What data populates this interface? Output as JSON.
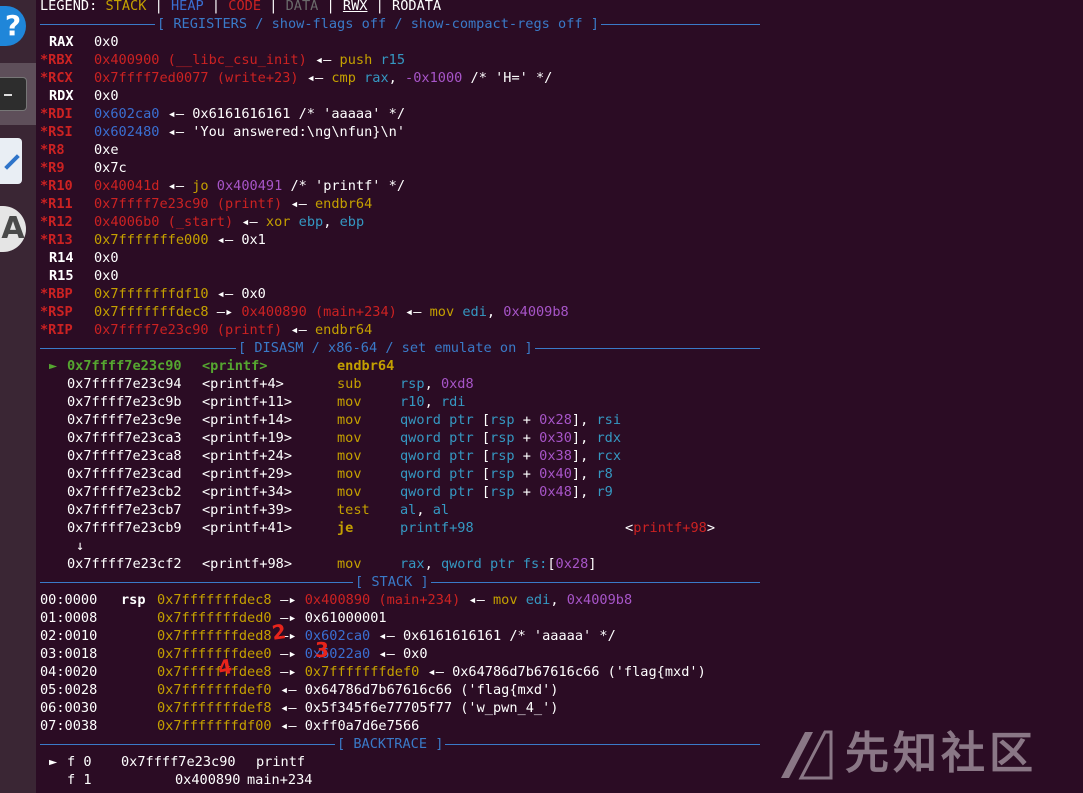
{
  "legend": {
    "label": "LEGEND:",
    "items": [
      "STACK",
      "HEAP",
      "CODE",
      "DATA",
      "RWX",
      "RODATA"
    ],
    "separator": "|"
  },
  "headers": {
    "registers": "[ REGISTERS / show-flags off / show-compact-regs off ]",
    "disasm": "[ DISASM / x86-64 / set emulate on ]",
    "stack": "[ STACK ]",
    "backtrace": "[ BACKTRACE ]"
  },
  "registers": [
    {
      "name": "RAX",
      "changed": false,
      "parts": [
        {
          "t": "0x0",
          "c": "w"
        }
      ]
    },
    {
      "name": "*RBX",
      "changed": true,
      "parts": [
        {
          "t": "0x400900 (__libc_csu_init)",
          "c": "r"
        },
        {
          "t": " ◂— ",
          "c": "w"
        },
        {
          "t": "push",
          "c": "y"
        },
        {
          "t": " ",
          "c": "w"
        },
        {
          "t": "r15",
          "c": "c"
        }
      ]
    },
    {
      "name": "*RCX",
      "changed": true,
      "parts": [
        {
          "t": "0x7ffff7ed0077 (write+23)",
          "c": "r"
        },
        {
          "t": " ◂— ",
          "c": "w"
        },
        {
          "t": "cmp",
          "c": "y"
        },
        {
          "t": " ",
          "c": "w"
        },
        {
          "t": "rax",
          "c": "c"
        },
        {
          "t": ", ",
          "c": "w"
        },
        {
          "t": "-0x1000",
          "c": "m"
        },
        {
          "t": " /* 'H=' */",
          "c": "w"
        }
      ]
    },
    {
      "name": "RDX",
      "changed": false,
      "parts": [
        {
          "t": "0x0",
          "c": "w"
        }
      ]
    },
    {
      "name": "*RDI",
      "changed": true,
      "parts": [
        {
          "t": "0x602ca0",
          "c": "b"
        },
        {
          "t": " ◂— 0x6161616161 /* 'aaaaa' */",
          "c": "w"
        }
      ]
    },
    {
      "name": "*RSI",
      "changed": true,
      "parts": [
        {
          "t": "0x602480",
          "c": "b"
        },
        {
          "t": " ◂— 'You answered:\\ng\\nfun}\\n'",
          "c": "w"
        }
      ]
    },
    {
      "name": "*R8",
      "changed": true,
      "parts": [
        {
          "t": "0xe",
          "c": "w"
        }
      ]
    },
    {
      "name": "*R9",
      "changed": true,
      "parts": [
        {
          "t": "0x7c",
          "c": "w"
        }
      ]
    },
    {
      "name": "*R10",
      "changed": true,
      "parts": [
        {
          "t": "0x40041d",
          "c": "r"
        },
        {
          "t": " ◂— ",
          "c": "w"
        },
        {
          "t": "jo",
          "c": "y"
        },
        {
          "t": " ",
          "c": "w"
        },
        {
          "t": "0x400491",
          "c": "m"
        },
        {
          "t": " /* 'printf' */",
          "c": "w"
        }
      ]
    },
    {
      "name": "*R11",
      "changed": true,
      "parts": [
        {
          "t": "0x7ffff7e23c90 (printf)",
          "c": "r"
        },
        {
          "t": " ◂— ",
          "c": "w"
        },
        {
          "t": "endbr64",
          "c": "y"
        }
      ]
    },
    {
      "name": "*R12",
      "changed": true,
      "parts": [
        {
          "t": "0x4006b0 (_start)",
          "c": "r"
        },
        {
          "t": " ◂— ",
          "c": "w"
        },
        {
          "t": "xor",
          "c": "y"
        },
        {
          "t": " ",
          "c": "w"
        },
        {
          "t": "ebp",
          "c": "c"
        },
        {
          "t": ", ",
          "c": "w"
        },
        {
          "t": "ebp",
          "c": "c"
        }
      ]
    },
    {
      "name": "*R13",
      "changed": true,
      "parts": [
        {
          "t": "0x7fffffffe000",
          "c": "y"
        },
        {
          "t": " ◂— 0x1",
          "c": "w"
        }
      ]
    },
    {
      "name": "R14",
      "changed": false,
      "parts": [
        {
          "t": "0x0",
          "c": "w"
        }
      ]
    },
    {
      "name": "R15",
      "changed": false,
      "parts": [
        {
          "t": "0x0",
          "c": "w"
        }
      ]
    },
    {
      "name": "*RBP",
      "changed": true,
      "parts": [
        {
          "t": "0x7fffffffdf10",
          "c": "y"
        },
        {
          "t": " ◂— 0x0",
          "c": "w"
        }
      ]
    },
    {
      "name": "*RSP",
      "changed": true,
      "parts": [
        {
          "t": "0x7fffffffdec8",
          "c": "y"
        },
        {
          "t": " —▸ ",
          "c": "w"
        },
        {
          "t": "0x400890 (main+234)",
          "c": "r"
        },
        {
          "t": " ◂— ",
          "c": "w"
        },
        {
          "t": "mov",
          "c": "y"
        },
        {
          "t": " ",
          "c": "w"
        },
        {
          "t": "edi",
          "c": "c"
        },
        {
          "t": ", ",
          "c": "w"
        },
        {
          "t": "0x4009b8",
          "c": "m"
        }
      ]
    },
    {
      "name": "*RIP",
      "changed": true,
      "parts": [
        {
          "t": "0x7ffff7e23c90 (printf)",
          "c": "r"
        },
        {
          "t": " ◂— ",
          "c": "w"
        },
        {
          "t": "endbr64",
          "c": "y"
        }
      ]
    }
  ],
  "disasm": [
    {
      "ptr": "►",
      "addr": "0x7ffff7e23c90",
      "sym": "<printf>",
      "mn": "endbr64",
      "op": "",
      "current": true
    },
    {
      "ptr": "",
      "addr": "0x7ffff7e23c94",
      "sym": "<printf+4>",
      "mn": "sub",
      "op": [
        {
          "t": "rsp",
          "c": "c"
        },
        {
          "t": ", ",
          "c": "w"
        },
        {
          "t": "0xd8",
          "c": "m"
        }
      ]
    },
    {
      "ptr": "",
      "addr": "0x7ffff7e23c9b",
      "sym": "<printf+11>",
      "mn": "mov",
      "op": [
        {
          "t": "r10",
          "c": "c"
        },
        {
          "t": ", ",
          "c": "w"
        },
        {
          "t": "rdi",
          "c": "c"
        }
      ]
    },
    {
      "ptr": "",
      "addr": "0x7ffff7e23c9e",
      "sym": "<printf+14>",
      "mn": "mov",
      "op": [
        {
          "t": "qword ptr",
          "c": "c"
        },
        {
          "t": " [",
          "c": "w"
        },
        {
          "t": "rsp",
          "c": "c"
        },
        {
          "t": " + ",
          "c": "w"
        },
        {
          "t": "0x28",
          "c": "m"
        },
        {
          "t": "], ",
          "c": "w"
        },
        {
          "t": "rsi",
          "c": "c"
        }
      ]
    },
    {
      "ptr": "",
      "addr": "0x7ffff7e23ca3",
      "sym": "<printf+19>",
      "mn": "mov",
      "op": [
        {
          "t": "qword ptr",
          "c": "c"
        },
        {
          "t": " [",
          "c": "w"
        },
        {
          "t": "rsp",
          "c": "c"
        },
        {
          "t": " + ",
          "c": "w"
        },
        {
          "t": "0x30",
          "c": "m"
        },
        {
          "t": "], ",
          "c": "w"
        },
        {
          "t": "rdx",
          "c": "c"
        }
      ]
    },
    {
      "ptr": "",
      "addr": "0x7ffff7e23ca8",
      "sym": "<printf+24>",
      "mn": "mov",
      "op": [
        {
          "t": "qword ptr",
          "c": "c"
        },
        {
          "t": " [",
          "c": "w"
        },
        {
          "t": "rsp",
          "c": "c"
        },
        {
          "t": " + ",
          "c": "w"
        },
        {
          "t": "0x38",
          "c": "m"
        },
        {
          "t": "], ",
          "c": "w"
        },
        {
          "t": "rcx",
          "c": "c"
        }
      ]
    },
    {
      "ptr": "",
      "addr": "0x7ffff7e23cad",
      "sym": "<printf+29>",
      "mn": "mov",
      "op": [
        {
          "t": "qword ptr",
          "c": "c"
        },
        {
          "t": " [",
          "c": "w"
        },
        {
          "t": "rsp",
          "c": "c"
        },
        {
          "t": " + ",
          "c": "w"
        },
        {
          "t": "0x40",
          "c": "m"
        },
        {
          "t": "], ",
          "c": "w"
        },
        {
          "t": "r8",
          "c": "c"
        }
      ]
    },
    {
      "ptr": "",
      "addr": "0x7ffff7e23cb2",
      "sym": "<printf+34>",
      "mn": "mov",
      "op": [
        {
          "t": "qword ptr",
          "c": "c"
        },
        {
          "t": " [",
          "c": "w"
        },
        {
          "t": "rsp",
          "c": "c"
        },
        {
          "t": " + ",
          "c": "w"
        },
        {
          "t": "0x48",
          "c": "m"
        },
        {
          "t": "], ",
          "c": "w"
        },
        {
          "t": "r9",
          "c": "c"
        }
      ]
    },
    {
      "ptr": "",
      "addr": "0x7ffff7e23cb7",
      "sym": "<printf+39>",
      "mn": "test",
      "op": [
        {
          "t": "al",
          "c": "c"
        },
        {
          "t": ", ",
          "c": "w"
        },
        {
          "t": "al",
          "c": "c"
        }
      ]
    },
    {
      "ptr": "",
      "addr": "0x7ffff7e23cb9",
      "sym": "<printf+41>",
      "mn": "je",
      "mnbold": true,
      "op": [
        {
          "t": "printf+98",
          "c": "c"
        }
      ],
      "extra": [
        {
          "t": "<",
          "c": "w"
        },
        {
          "t": "printf+98",
          "c": "r"
        },
        {
          "t": ">",
          "c": "w"
        }
      ]
    },
    {
      "arrow": "↓"
    },
    {
      "ptr": "",
      "addr": "0x7ffff7e23cf2",
      "sym": "<printf+98>",
      "mn": "mov",
      "op": [
        {
          "t": "rax",
          "c": "c"
        },
        {
          "t": ", ",
          "c": "w"
        },
        {
          "t": "qword ptr fs:",
          "c": "c"
        },
        {
          "t": "[",
          "c": "w"
        },
        {
          "t": "0x28",
          "c": "m"
        },
        {
          "t": "]",
          "c": "w"
        }
      ]
    }
  ],
  "stack": [
    {
      "idx": "00:0000",
      "rsp": "rsp",
      "addr": "0x7fffffffdec8",
      "rest": [
        {
          "t": " —▸ ",
          "c": "w"
        },
        {
          "t": "0x400890 (main+234)",
          "c": "r"
        },
        {
          "t": " ◂— ",
          "c": "w"
        },
        {
          "t": "mov",
          "c": "y"
        },
        {
          "t": " ",
          "c": "w"
        },
        {
          "t": "edi",
          "c": "c"
        },
        {
          "t": ", ",
          "c": "w"
        },
        {
          "t": "0x4009b8",
          "c": "m"
        }
      ]
    },
    {
      "idx": "01:0008",
      "rsp": "",
      "addr": "0x7fffffffded0",
      "rest": [
        {
          "t": " —▸ 0x61000001",
          "c": "w"
        }
      ]
    },
    {
      "idx": "02:0010",
      "rsp": "",
      "addr": "0x7fffffffded8",
      "rest": [
        {
          "t": " —▸ ",
          "c": "w"
        },
        {
          "t": "0x602ca0",
          "c": "b"
        },
        {
          "t": " ◂— 0x6161616161 /* 'aaaaa' */",
          "c": "w"
        }
      ]
    },
    {
      "idx": "03:0018",
      "rsp": "",
      "addr": "0x7fffffffdee0",
      "rest": [
        {
          "t": " —▸ ",
          "c": "w"
        },
        {
          "t": "0x6022a0",
          "c": "b"
        },
        {
          "t": " ◂— 0x0",
          "c": "w"
        }
      ]
    },
    {
      "idx": "04:0020",
      "rsp": "",
      "addr": "0x7fffffffdee8",
      "rest": [
        {
          "t": " —▸ ",
          "c": "w"
        },
        {
          "t": "0x7fffffffdef0",
          "c": "y"
        },
        {
          "t": " ◂— 0x64786d7b67616c66 ('flag{mxd')",
          "c": "w"
        }
      ]
    },
    {
      "idx": "05:0028",
      "rsp": "",
      "addr": "0x7fffffffdef0",
      "rest": [
        {
          "t": " ◂— 0x64786d7b67616c66 ('flag{mxd')",
          "c": "w"
        }
      ]
    },
    {
      "idx": "06:0030",
      "rsp": "",
      "addr": "0x7fffffffdef8",
      "rest": [
        {
          "t": " ◂— 0x5f345f6e77705f77 ('w_pwn_4_')",
          "c": "w"
        }
      ]
    },
    {
      "idx": "07:0038",
      "rsp": "",
      "addr": "0x7fffffffdf00",
      "rest": [
        {
          "t": " ◂— 0xff0a7d6e7566",
          "c": "w"
        }
      ]
    }
  ],
  "backtrace": [
    {
      "ptr": "►",
      "frame": "f 0",
      "addr": "0x7ffff7e23c90",
      "sym": "printf"
    },
    {
      "ptr": "",
      "frame": "f 1",
      "addr": "0x400890",
      "sym": "main+234"
    }
  ],
  "annotations": [
    "2",
    "3",
    "4"
  ],
  "watermark": "先知社区",
  "dock": {
    "help_glyph": "?",
    "store_glyph": "A"
  }
}
